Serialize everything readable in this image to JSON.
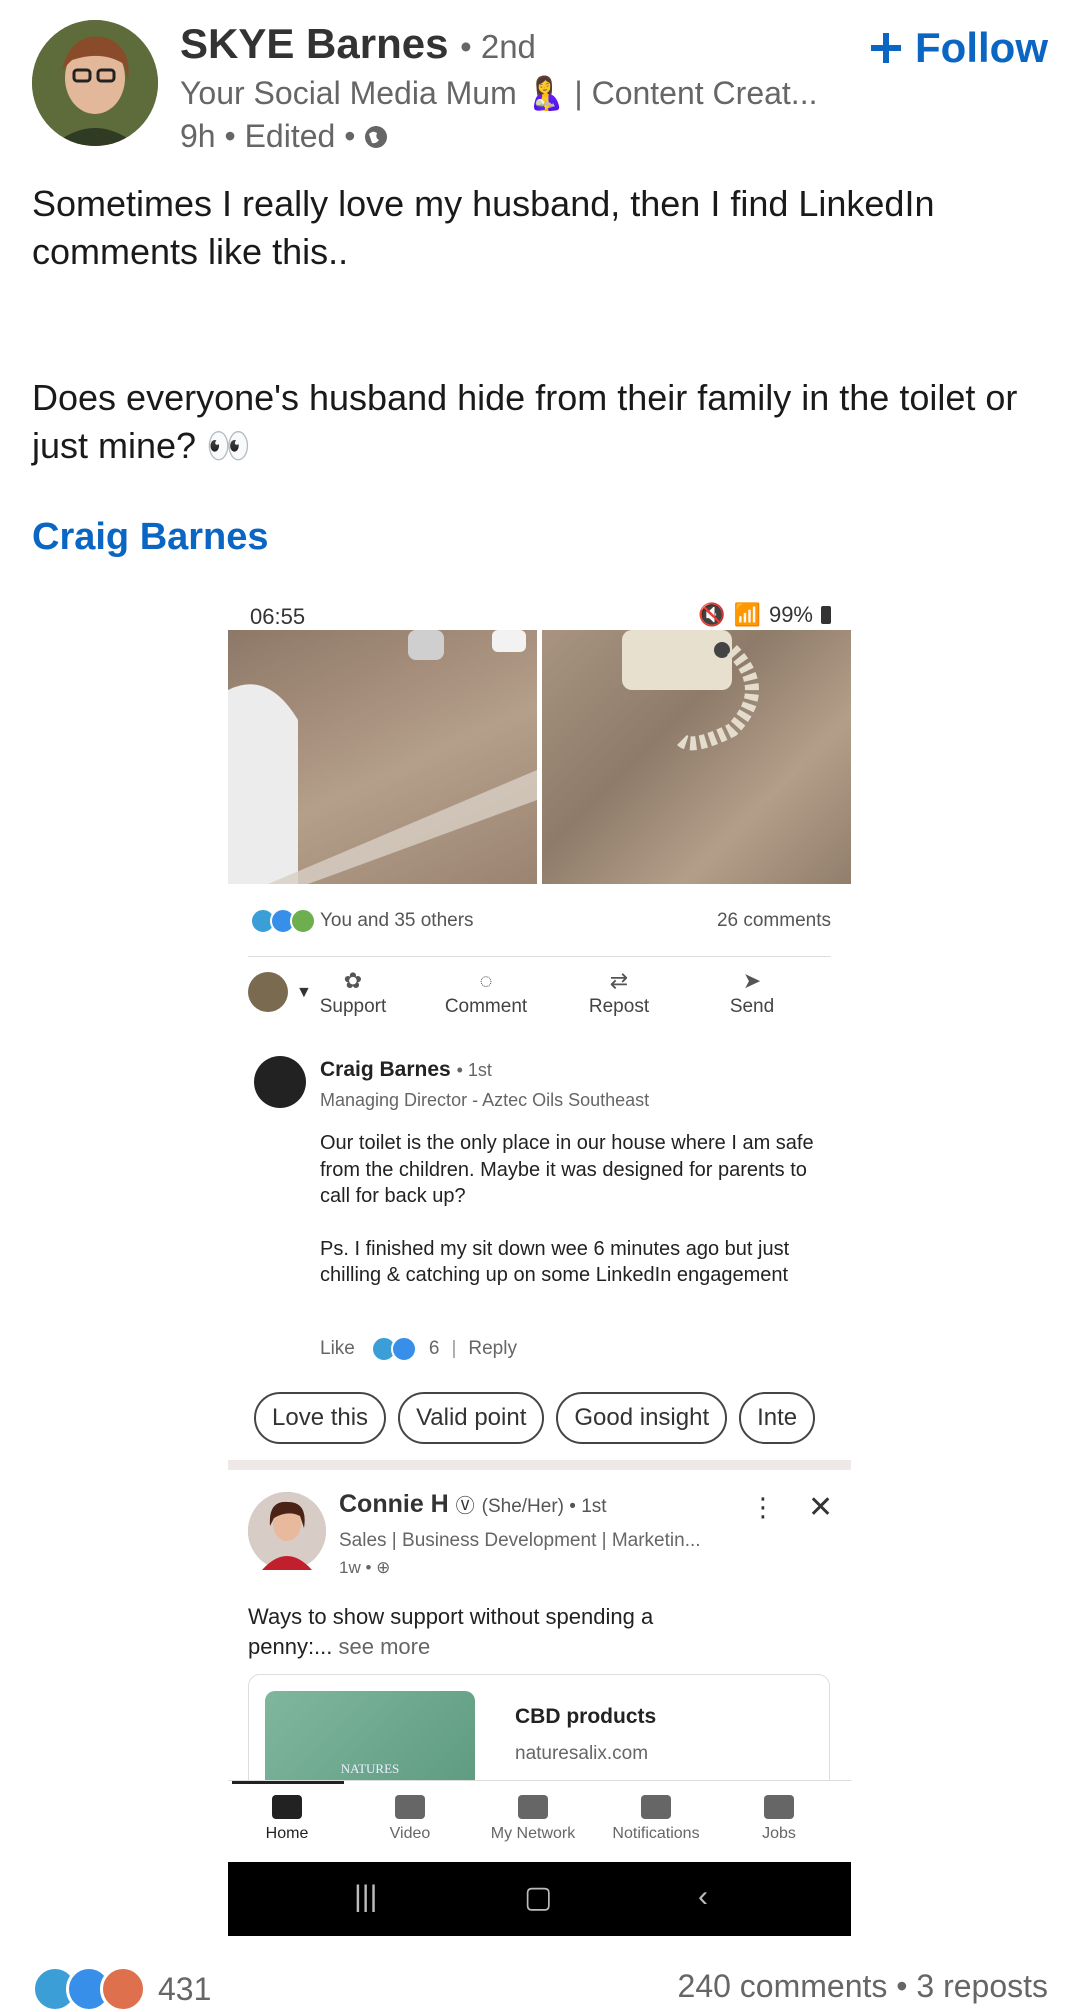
{
  "post": {
    "author_name": "SKYE Barnes",
    "author_degree": "• 2nd",
    "author_headline": "Your Social Media Mum 🤱 | Content Creat...",
    "meta": "9h • Edited •",
    "follow_label": "Follow",
    "text_line1": "Sometimes I really love my husband, then I find LinkedIn comments like this..",
    "text_line2": "Does everyone's husband hide from their family in the toilet or just mine? 👀",
    "mention": "Craig Barnes"
  },
  "screenshot": {
    "status_time": "06:55",
    "status_battery": "99%",
    "reactions_text": "You and 35 others",
    "comments_count": "26 comments",
    "actions": [
      "Support",
      "Comment",
      "Repost",
      "Send"
    ],
    "comment": {
      "author": "Craig Barnes",
      "degree": "• 1st",
      "headline": "Managing Director - Aztec Oils Southeast",
      "body_p1": "Our toilet is the only place in our house where I am safe from the children. Maybe it was designed for parents to call for back up?",
      "body_p2": "Ps. I finished my sit down wee 6 minutes ago but just chilling & catching up on some LinkedIn engagement",
      "like_label": "Like",
      "like_count": "6",
      "reply_label": "Reply"
    },
    "chips": [
      "Love this",
      "Valid point",
      "Good insight",
      "Inte"
    ],
    "suggested": {
      "author": "Connie H",
      "pronouns": "(She/Her) • 1st",
      "headline": "Sales | Business Development | Marketin...",
      "meta": "1w •",
      "body": "Ways to show support without spending a penny:...",
      "see_more": "see more",
      "card_title": "CBD products",
      "card_url": "naturesalix.com",
      "card_logo": "NATURES"
    },
    "nav": [
      "Home",
      "Video",
      "My Network",
      "Notifications",
      "Jobs"
    ]
  },
  "footer": {
    "reaction_count": "431",
    "stats": "240 comments • 3 reposts"
  },
  "colors": {
    "accent": "#0a66c2"
  }
}
